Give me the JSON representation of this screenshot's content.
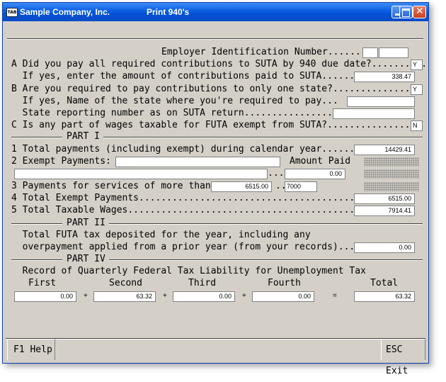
{
  "window": {
    "company": "Sample Company, Inc.",
    "title": "Print 940's",
    "app_icon": "TAB"
  },
  "titlebar_buttons": {
    "minimize": "minimize-icon",
    "maximize": "maximize-icon",
    "close": "close-icon"
  },
  "employer": {
    "label": "Employer Identification Number........",
    "value1": "",
    "value2": ""
  },
  "qA": {
    "text": "A Did you pay all required contributions to SUTA by 940 due date?..........",
    "value": "Y",
    "sub_text": "  If yes, enter the amount of contributions paid to SUTA........",
    "amount": "338.47"
  },
  "qB": {
    "text": "B Are you required to pay contributions to only one state?...............",
    "value": "Y",
    "sub_text": "  If yes, Name of the state where you're required to pay...",
    "state_name": "",
    "sub_text2": "  State reporting number as on SUTA return.................",
    "state_number": ""
  },
  "qC": {
    "text": "C Is any part of wages taxable for FUTA exempt from SUTA?................",
    "value": "N"
  },
  "part1": {
    "heading": "PART I",
    "line1": {
      "text": "1 Total payments (including exempt) during calendar year........",
      "value": "14429.41"
    },
    "line2": {
      "text": "2 Exempt Payments:",
      "amount_header": "Amount Paid",
      "desc1": "",
      "desc2": "",
      "dots": "...",
      "amount": "0.00"
    },
    "line3": {
      "text": "3 Payments for services of more than",
      "threshold": "6515.00",
      "dots": "..",
      "value": "7000"
    },
    "line4": {
      "text": "4 Total Exempt Payments...........................................",
      "value": "6515.00"
    },
    "line5": {
      "text": "5 Total Taxable Wages.............................................",
      "value": "7914.41"
    }
  },
  "part2": {
    "heading": "PART II",
    "line1": "  Total FUTA tax deposited for the year, including any",
    "line2": "  overpayment applied from a prior year (from your records).....",
    "value": "0.00"
  },
  "part4": {
    "heading": "PART IV",
    "caption": "  Record of Quarterly Federal Tax Liability for Unemployment Tax",
    "headers": [
      "First",
      "Second",
      "Third",
      "Fourth",
      "Total"
    ],
    "values": [
      "0.00",
      "63.32",
      "0.00",
      "0.00",
      "63.32"
    ],
    "plus": "+",
    "equals": "="
  },
  "footer": {
    "help": "F1 Help",
    "exit": "ESC Exit"
  }
}
